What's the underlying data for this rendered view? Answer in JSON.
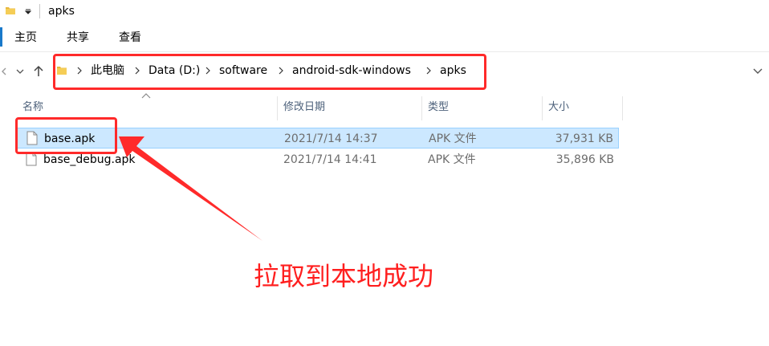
{
  "window": {
    "title": "apks"
  },
  "ribbon": {
    "tabs": [
      "主页",
      "共享",
      "查看"
    ]
  },
  "address": {
    "crumbs": [
      "此电脑",
      "Data (D:)",
      "software",
      "android-sdk-windows",
      "apks"
    ]
  },
  "columns": {
    "name": "名称",
    "date": "修改日期",
    "type": "类型",
    "size": "大小"
  },
  "files": [
    {
      "name": "base.apk",
      "date": "2021/7/14 14:37",
      "type": "APK 文件",
      "size": "37,931 KB",
      "selected": true
    },
    {
      "name": "base_debug.apk",
      "date": "2021/7/14 14:41",
      "type": "APK 文件",
      "size": "35,896 KB",
      "selected": false
    }
  ],
  "annotation": {
    "text": "拉取到本地成功",
    "color": "#ff2a2a"
  },
  "icons": {
    "folder": "folder-icon",
    "back": "back-arrow-icon",
    "forward": "forward-arrow-icon",
    "recent": "chevron-down-icon",
    "up": "up-arrow-icon",
    "file": "file-icon"
  },
  "colors": {
    "selection_bg": "#cce8ff",
    "selection_border": "#99d1ff",
    "accent": "#1979ca",
    "header_text": "#4c607a"
  }
}
